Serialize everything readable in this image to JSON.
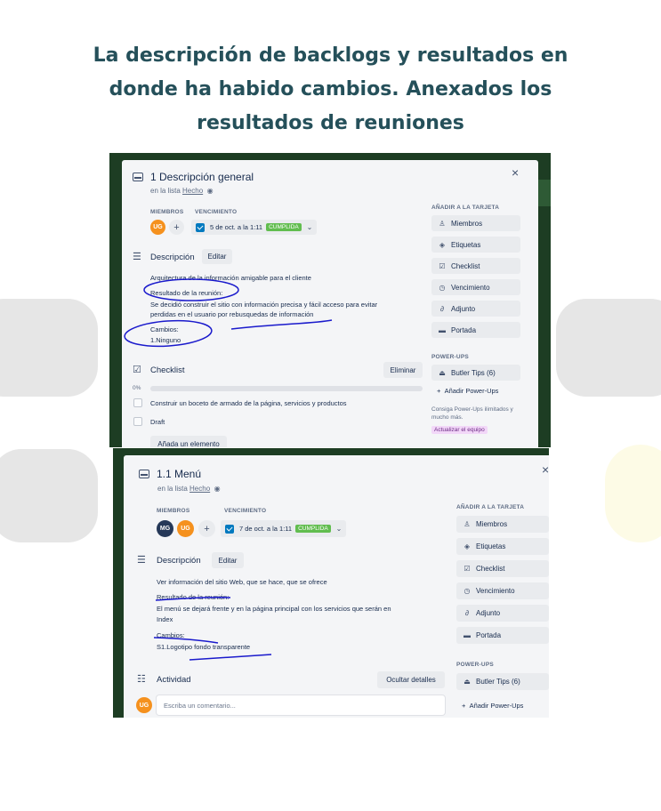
{
  "page_title": "La descripción de backlogs y resultados en\ndonde ha habido cambios. Anexados los\nresultados de reuniones",
  "card1": {
    "title": "1 Descripción general",
    "list_prefix": "en la lista",
    "list_name": "Hecho",
    "members_label": "MIEMBROS",
    "due_label": "VENCIMIENTO",
    "members": [
      {
        "initials": "UG",
        "color": "#f5911e"
      }
    ],
    "due_date": "5 de oct. a la 1:11",
    "due_badge": "CUMPLIDA",
    "description_label": "Descripción",
    "edit_button": "Editar",
    "description_lines": [
      "Arquitectura de la información amigable para el cliente",
      "Resultado de la reunión:",
      "Se decidió construir el sitio con información precisa y fácil acceso para evitar",
      "perdidas en el usuario por rebusquedas de información",
      "Cambios:",
      "1.Ninguno"
    ],
    "checklist_label": "Checklist",
    "delete_button": "Eliminar",
    "progress": "0%",
    "progress_value": 0,
    "checklist_items": [
      "Construir un boceto de armado de la página, servicios y productos",
      "Draft"
    ],
    "add_item_button": "Añada un elemento",
    "sidebar_heading": "AÑADIR A LA TARJETA",
    "sidebar_buttons": [
      {
        "icon": "person-icon",
        "glyph": "♙",
        "label": "Miembros"
      },
      {
        "icon": "tag-icon",
        "glyph": "◈",
        "label": "Etiquetas"
      },
      {
        "icon": "checklist-icon",
        "glyph": "☑",
        "label": "Checklist"
      },
      {
        "icon": "clock-icon",
        "glyph": "◷",
        "label": "Vencimiento"
      },
      {
        "icon": "paperclip-icon",
        "glyph": "∂",
        "label": "Adjunto"
      },
      {
        "icon": "cover-icon",
        "glyph": "▬",
        "label": "Portada"
      }
    ],
    "powerups_heading": "POWER-UPS",
    "butler_button": "Butler Tips (6)",
    "add_powerup": "Añadir Power-Ups",
    "powerup_note": "Consiga Power-Ups ilimitados y mucho más.",
    "upgrade_tag": "Actualizar el equipo"
  },
  "card2": {
    "title": "1.1 Menú",
    "list_prefix": "en la lista",
    "list_name": "Hecho",
    "members_label": "MIEMBROS",
    "due_label": "VENCIMIENTO",
    "members": [
      {
        "initials": "MG",
        "color": "#253858"
      },
      {
        "initials": "UG",
        "color": "#f5911e"
      }
    ],
    "due_date": "7 de oct. a la 1:11",
    "due_badge": "CUMPLIDA",
    "description_label": "Descripción",
    "edit_button": "Editar",
    "description_lines": [
      "Ver información del sitio Web, que se hace, que se ofrece",
      "Resultado de la reunión:",
      "El menú se dejará frente y en la página principal con los servicios que serán en",
      "Index",
      "Cambios:",
      "S1.Logotipo fondo transparente"
    ],
    "activity_label": "Actividad",
    "hide_details_button": "Ocultar detalles",
    "comment_placeholder": "Escriba un comentario...",
    "commenter_initials": "UG",
    "sidebar_heading": "AÑADIR A LA TARJETA",
    "sidebar_buttons": [
      {
        "icon": "person-icon",
        "glyph": "♙",
        "label": "Miembros"
      },
      {
        "icon": "tag-icon",
        "glyph": "◈",
        "label": "Etiquetas"
      },
      {
        "icon": "checklist-icon",
        "glyph": "☑",
        "label": "Checklist"
      },
      {
        "icon": "clock-icon",
        "glyph": "◷",
        "label": "Vencimiento"
      },
      {
        "icon": "paperclip-icon",
        "glyph": "∂",
        "label": "Adjunto"
      },
      {
        "icon": "cover-icon",
        "glyph": "▬",
        "label": "Portada"
      }
    ],
    "powerups_heading": "POWER-UPS",
    "butler_button": "Butler Tips (6)",
    "add_powerup": "Añadir Power-Ups"
  },
  "colors": {
    "title": "#25505a",
    "badge_green": "#61bd4f",
    "checkbox_blue": "#0079bf",
    "ink_annotation": "#1a1acc",
    "board_green": "#1d3d23"
  }
}
